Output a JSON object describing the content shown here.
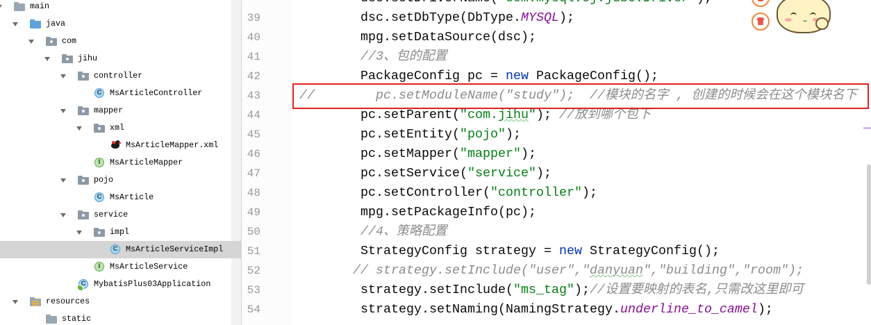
{
  "syntax_colors": {
    "plain": "#080808",
    "keyword": "#0033b3",
    "string": "#067d17",
    "static_field": "#871094",
    "comment": "#8c8c8c",
    "line_number": "#999999",
    "tree_selection": "#d5d5d5",
    "highlight_box": "#e02020"
  },
  "icon_glyphs": {
    "class-icon": "C",
    "interface-icon": "I",
    "spring-boot-class-icon": "C"
  },
  "decorations": {
    "badge_icon": "shirt-badge-icon",
    "character": "cartoon-cat-sticker"
  },
  "project_tree": {
    "nodes": [
      {
        "label": "main",
        "icon": "folder-icon",
        "expanded": true,
        "children": [
          {
            "label": "java",
            "icon": "source-folder-icon",
            "expanded": true,
            "children": [
              {
                "label": "com",
                "icon": "package-icon",
                "expanded": true,
                "children": [
                  {
                    "label": "jihu",
                    "icon": "package-icon",
                    "expanded": true,
                    "children": [
                      {
                        "label": "controller",
                        "icon": "package-icon",
                        "expanded": true,
                        "children": [
                          {
                            "label": "MsArticleController",
                            "icon": "class-icon"
                          }
                        ]
                      },
                      {
                        "label": "mapper",
                        "icon": "package-icon",
                        "expanded": true,
                        "children": [
                          {
                            "label": "xml",
                            "icon": "package-icon",
                            "expanded": true,
                            "children": [
                              {
                                "label": "MsArticleMapper.xml",
                                "icon": "mybatis-xml-icon"
                              }
                            ]
                          },
                          {
                            "label": "MsArticleMapper",
                            "icon": "interface-icon"
                          }
                        ]
                      },
                      {
                        "label": "pojo",
                        "icon": "package-icon",
                        "expanded": true,
                        "children": [
                          {
                            "label": "MsArticle",
                            "icon": "class-icon"
                          }
                        ]
                      },
                      {
                        "label": "service",
                        "icon": "package-icon",
                        "expanded": true,
                        "children": [
                          {
                            "label": "impl",
                            "icon": "package-icon",
                            "expanded": true,
                            "children": [
                              {
                                "label": "MsArticleServiceImpl",
                                "icon": "class-icon",
                                "selected": true
                              }
                            ]
                          },
                          {
                            "label": "MsArticleService",
                            "icon": "interface-icon"
                          }
                        ]
                      },
                      {
                        "label": "MybatisPlus03Application",
                        "icon": "spring-boot-class-icon"
                      }
                    ]
                  }
                ]
              }
            ]
          },
          {
            "label": "resources",
            "icon": "resources-folder-icon",
            "expanded": true,
            "children": [
              {
                "label": "static",
                "icon": "folder-icon"
              }
            ]
          }
        ]
      }
    ]
  },
  "editor": {
    "lines": [
      {
        "tokens": [
          {
            "text": "        dsc.setDriverName(",
            "style": "plain"
          },
          {
            "text": "\"com.mysql.cj.jdbc.Driver\"",
            "style": "string"
          },
          {
            "text": ");",
            "style": "plain"
          }
        ]
      },
      {
        "number": 39,
        "tokens": [
          {
            "text": "        dsc.setDbType(DbType.",
            "style": "plain"
          },
          {
            "text": "MYSQL",
            "style": "static"
          },
          {
            "text": ");",
            "style": "plain"
          }
        ]
      },
      {
        "number": 40,
        "tokens": [
          {
            "text": "        mpg.setDataSource(dsc);",
            "style": "plain"
          }
        ]
      },
      {
        "number": 41,
        "tokens": [
          {
            "text": "        ",
            "style": "plain"
          },
          {
            "text": "//3、包的配置",
            "style": "comment"
          }
        ]
      },
      {
        "number": 42,
        "tokens": [
          {
            "text": "        PackageConfig pc = ",
            "style": "plain"
          },
          {
            "text": "new",
            "style": "keyword"
          },
          {
            "text": " PackageConfig();",
            "style": "plain"
          }
        ]
      },
      {
        "number": 43,
        "tokens": [
          {
            "text": "//        pc.setModuleName(\"study\");  //模块的名字 , 创建的时候会在这个模块名下",
            "style": "comment"
          }
        ]
      },
      {
        "number": 44,
        "tokens": [
          {
            "text": "        pc.setParent(",
            "style": "plain"
          },
          {
            "text": "\"com.",
            "style": "string"
          },
          {
            "text": "jihu",
            "style": "string",
            "typo": true
          },
          {
            "text": "\"",
            "style": "string"
          },
          {
            "text": "); ",
            "style": "plain"
          },
          {
            "text": "//放到哪个包下",
            "style": "comment"
          }
        ]
      },
      {
        "number": 45,
        "tokens": [
          {
            "text": "        pc.setEntity(",
            "style": "plain"
          },
          {
            "text": "\"pojo\"",
            "style": "string"
          },
          {
            "text": ");",
            "style": "plain"
          }
        ]
      },
      {
        "number": 46,
        "tokens": [
          {
            "text": "        pc.setMapper(",
            "style": "plain"
          },
          {
            "text": "\"mapper\"",
            "style": "string"
          },
          {
            "text": ");",
            "style": "plain"
          }
        ]
      },
      {
        "number": 47,
        "tokens": [
          {
            "text": "        pc.setService(",
            "style": "plain"
          },
          {
            "text": "\"service\"",
            "style": "string"
          },
          {
            "text": ");",
            "style": "plain"
          }
        ]
      },
      {
        "number": 48,
        "tokens": [
          {
            "text": "        pc.setController(",
            "style": "plain"
          },
          {
            "text": "\"controller\"",
            "style": "string"
          },
          {
            "text": ");",
            "style": "plain"
          }
        ]
      },
      {
        "number": 49,
        "tokens": [
          {
            "text": "        mpg.setPackageInfo(pc);",
            "style": "plain"
          }
        ]
      },
      {
        "number": 50,
        "tokens": [
          {
            "text": "        ",
            "style": "plain"
          },
          {
            "text": "//4、策略配置",
            "style": "comment"
          }
        ]
      },
      {
        "number": 51,
        "tokens": [
          {
            "text": "        StrategyConfig strategy = ",
            "style": "plain"
          },
          {
            "text": "new",
            "style": "keyword"
          },
          {
            "text": " StrategyConfig();",
            "style": "plain"
          }
        ]
      },
      {
        "number": 52,
        "tokens": [
          {
            "text": "       ",
            "style": "plain"
          },
          {
            "text": "// strategy.setInclude(\"user\",\"",
            "style": "comment"
          },
          {
            "text": "danyuan",
            "style": "comment",
            "typo": true
          },
          {
            "text": "\",\"building\",\"room\");",
            "style": "comment"
          }
        ]
      },
      {
        "number": 53,
        "tokens": [
          {
            "text": "        strategy.setInclude(",
            "style": "plain"
          },
          {
            "text": "\"ms_tag\"",
            "style": "string"
          },
          {
            "text": ");",
            "style": "plain"
          },
          {
            "text": "//设置要映射的表名,只需改这里即可",
            "style": "comment"
          }
        ]
      },
      {
        "number": 54,
        "tokens": [
          {
            "text": "        strategy.setNaming(NamingStrategy.",
            "style": "plain"
          },
          {
            "text": "underline_to_camel",
            "style": "static"
          },
          {
            "text": ");",
            "style": "plain"
          }
        ]
      }
    ]
  }
}
